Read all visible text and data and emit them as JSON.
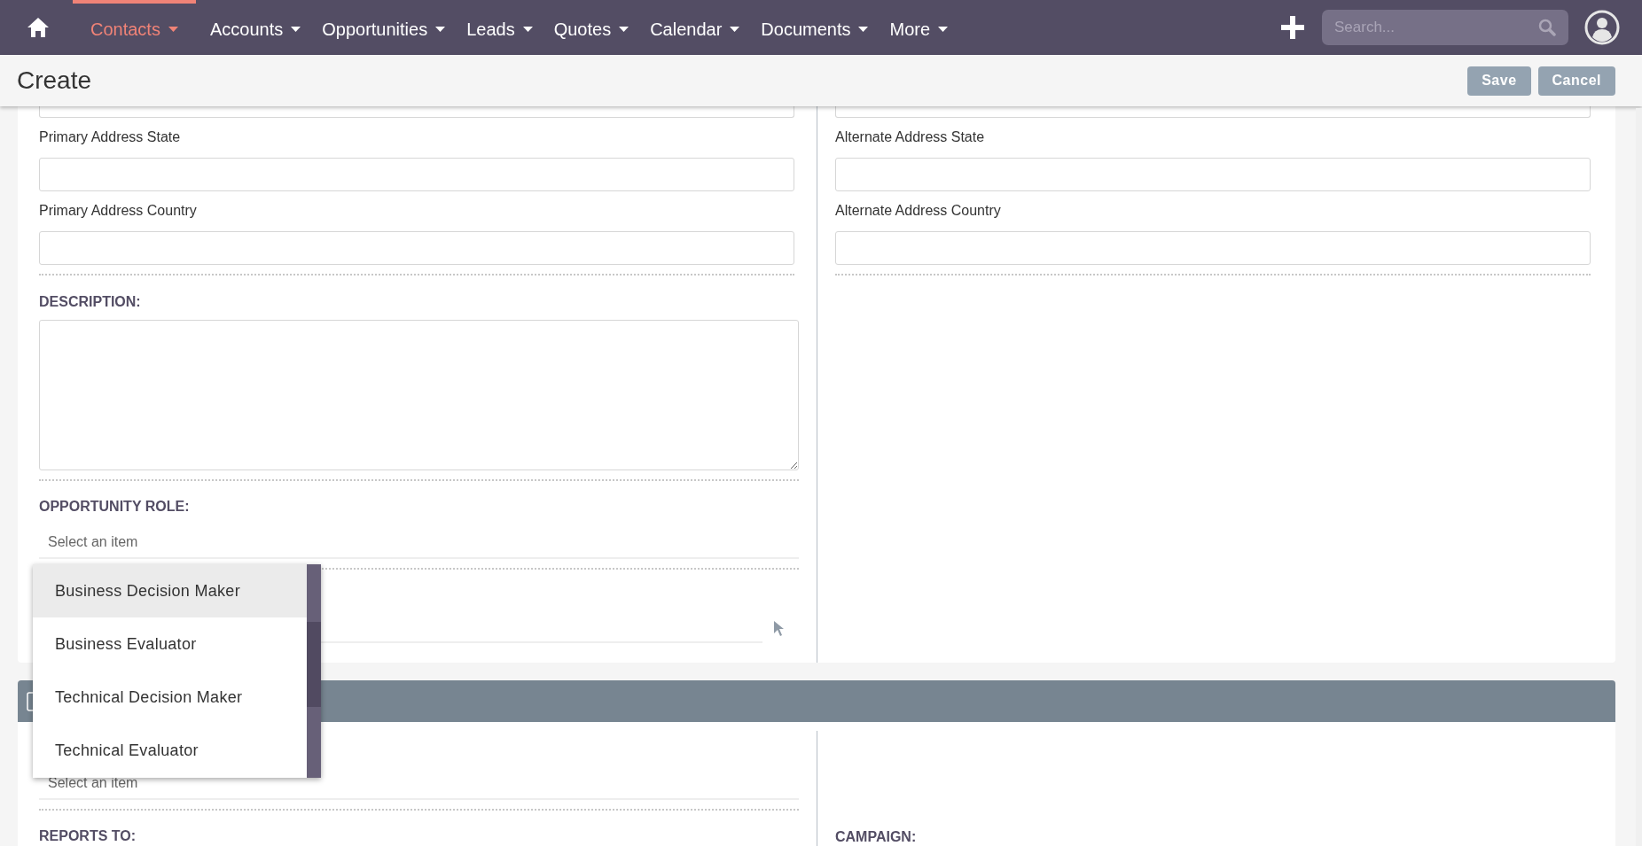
{
  "nav": {
    "items": [
      {
        "label": "Contacts",
        "selected": true
      },
      {
        "label": "Accounts",
        "selected": false
      },
      {
        "label": "Opportunities",
        "selected": false
      },
      {
        "label": "Leads",
        "selected": false
      },
      {
        "label": "Quotes",
        "selected": false
      },
      {
        "label": "Calendar",
        "selected": false
      },
      {
        "label": "Documents",
        "selected": false
      },
      {
        "label": "More",
        "selected": false
      }
    ],
    "search": {
      "placeholder": "Search..."
    }
  },
  "header": {
    "title": "Create",
    "buttons": [
      "Save",
      "Cancel"
    ]
  },
  "section_1": {
    "left_fields": [
      {
        "label": "Primary Address State"
      },
      {
        "label": "Primary Address Country"
      }
    ],
    "right_fields": [
      {
        "label": "Alternate Address State"
      },
      {
        "label": "Alternate Address Country"
      }
    ],
    "description_label": "DESCRIPTION:",
    "opportunity_role": {
      "label": "OPPORTUNITY ROLE:",
      "placeholder": "Select an item"
    }
  },
  "section_2": {
    "select": {
      "placeholder": "Select an item"
    },
    "reports_to_label": "REPORTS TO:",
    "campaign_label": "CAMPAIGN:"
  },
  "dropdown": {
    "options": [
      {
        "label": "Business Decision Maker",
        "selected": true
      },
      {
        "label": "Business Evaluator",
        "selected": false
      },
      {
        "label": "Technical Decision Maker",
        "selected": false
      },
      {
        "label": "Technical Evaluator",
        "selected": false
      }
    ]
  }
}
